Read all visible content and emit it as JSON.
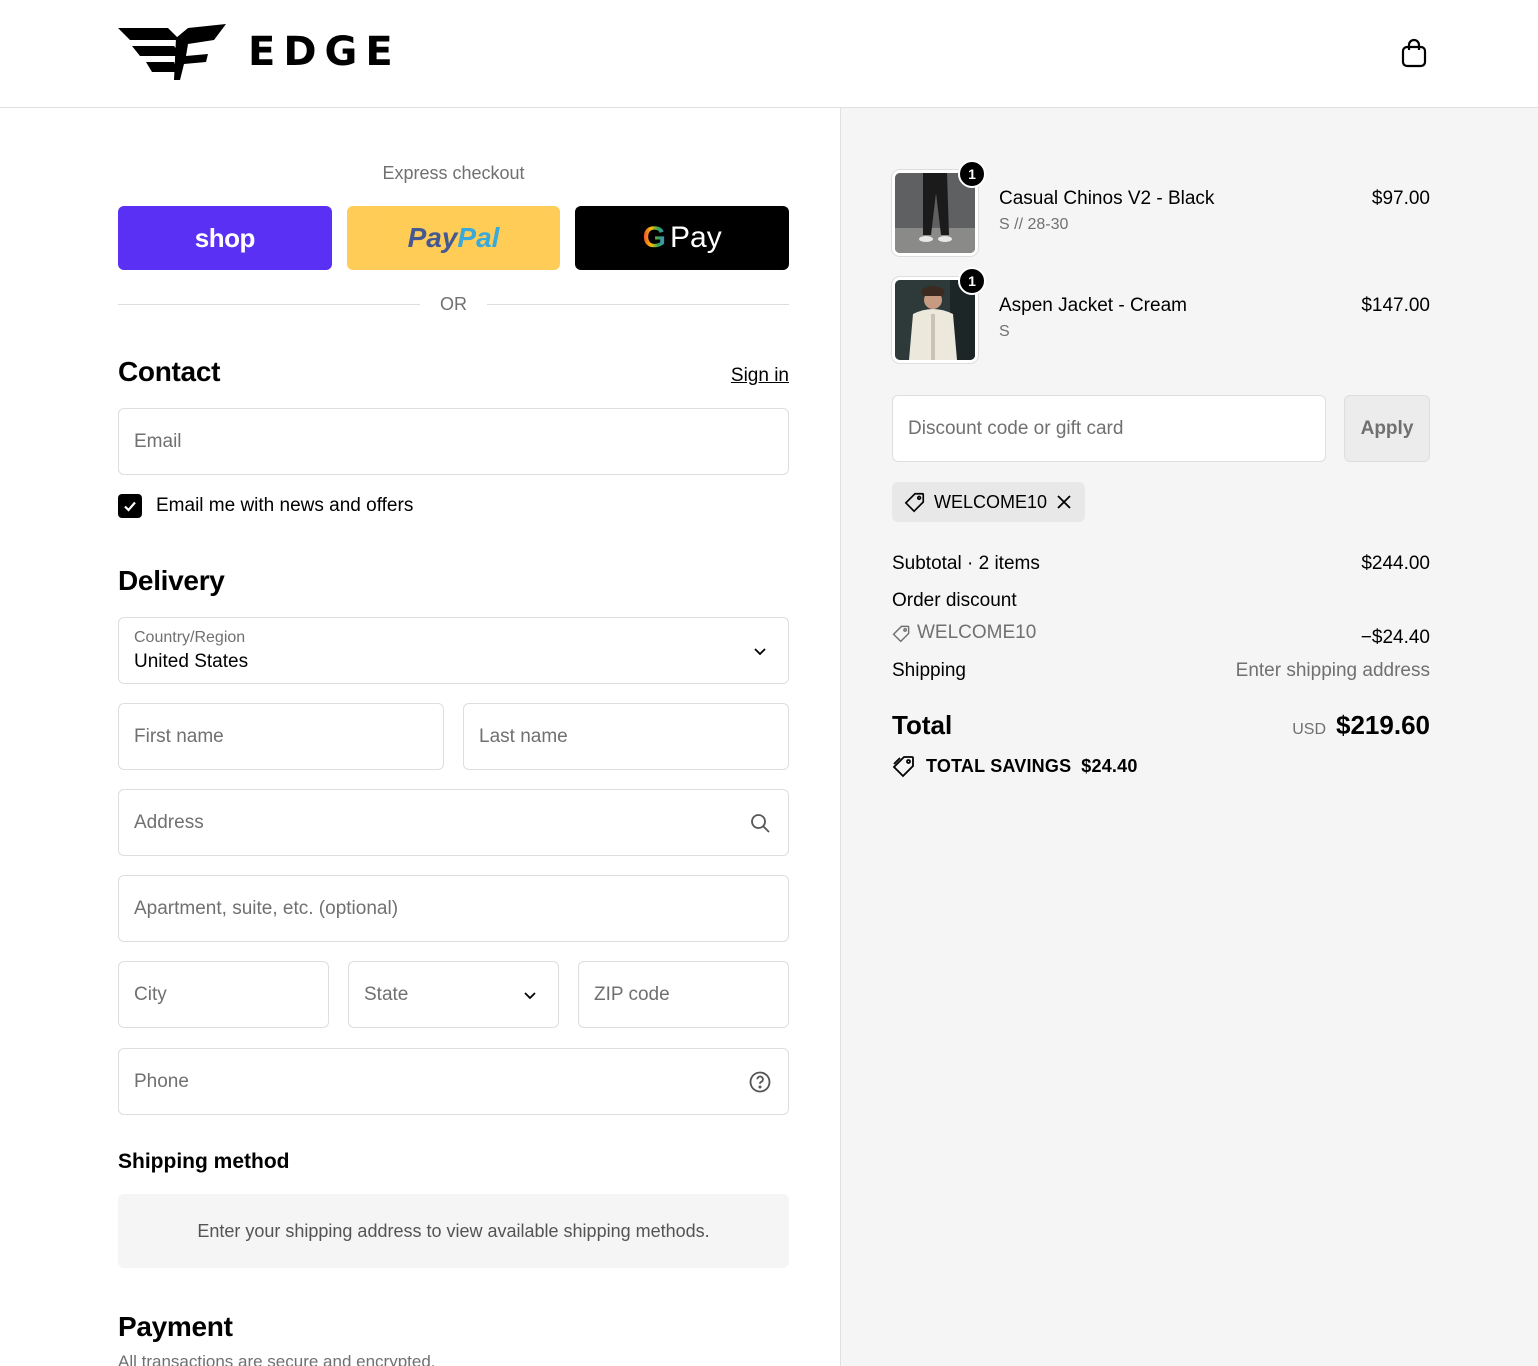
{
  "header": {
    "brand": "EDGE",
    "cart_icon": "shopping-bag-icon"
  },
  "express": {
    "title": "Express checkout",
    "shop_label": "shop",
    "paypal_part1": "Pay",
    "paypal_part2": "Pal",
    "gpay_g": "G",
    "gpay_label": "Pay",
    "or_label": "OR"
  },
  "contact": {
    "heading": "Contact",
    "sign_in": "Sign in",
    "email_placeholder": "Email",
    "newsletter_label": "Email me with news and offers",
    "newsletter_checked": true
  },
  "delivery": {
    "heading": "Delivery",
    "country_label": "Country/Region",
    "country_value": "United States",
    "first_name_placeholder": "First name",
    "last_name_placeholder": "Last name",
    "address_placeholder": "Address",
    "apartment_placeholder": "Apartment, suite, etc. (optional)",
    "city_placeholder": "City",
    "state_placeholder": "State",
    "zip_placeholder": "ZIP code",
    "phone_placeholder": "Phone"
  },
  "shipping_method": {
    "heading": "Shipping method",
    "notice": "Enter your shipping address to view available shipping methods."
  },
  "payment": {
    "heading": "Payment",
    "subtitle": "All transactions are secure and encrypted."
  },
  "summary": {
    "items": [
      {
        "name": "Casual Chinos V2 - Black",
        "variant": "S // 28-30",
        "price": "$97.00",
        "qty": "1"
      },
      {
        "name": "Aspen Jacket - Cream",
        "variant": "S",
        "price": "$147.00",
        "qty": "1"
      }
    ],
    "discount_placeholder": "Discount code or gift card",
    "apply_label": "Apply",
    "applied_code": "WELCOME10",
    "subtotal_label": "Subtotal · 2 items",
    "subtotal_value": "$244.00",
    "order_discount_label": "Order discount",
    "order_discount_code": "WELCOME10",
    "order_discount_value": "−$24.40",
    "shipping_label": "Shipping",
    "shipping_value": "Enter shipping address",
    "total_label": "Total",
    "currency": "USD",
    "total_value": "$219.60",
    "savings_label": "TOTAL SAVINGS",
    "savings_value": "$24.40"
  },
  "colors": {
    "shop_purple": "#5a31f4",
    "paypal_yellow": "#ffc439",
    "gpay_black": "#000000",
    "summary_bg": "#f5f5f5"
  }
}
